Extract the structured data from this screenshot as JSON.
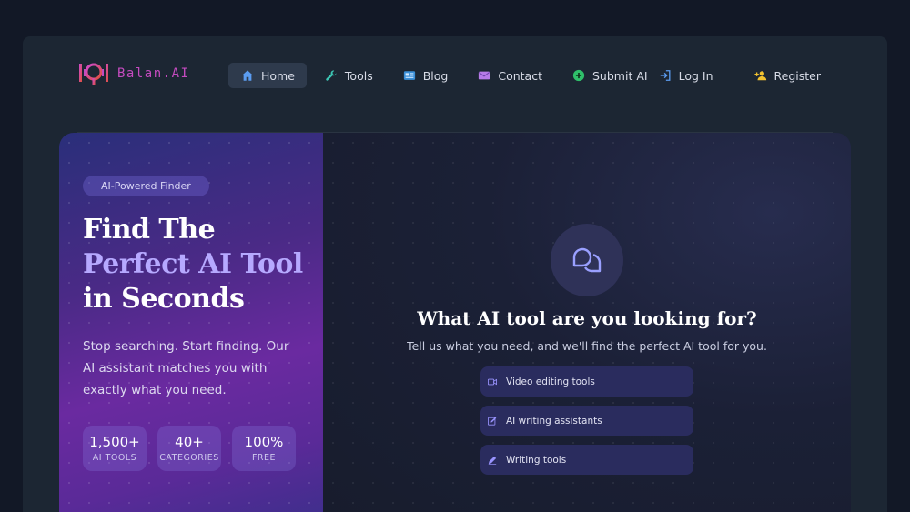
{
  "brand": {
    "name": "Balan.AI"
  },
  "nav": {
    "home": "Home",
    "tools": "Tools",
    "blog": "Blog",
    "contact": "Contact",
    "submit": "Submit AI",
    "login": "Log In",
    "register": "Register"
  },
  "hero": {
    "badge": "AI-Powered Finder",
    "headline_1": "Find The ",
    "headline_hl": "Perfect AI Tool",
    "headline_2": " in Seconds",
    "subtext": "Stop searching. Start finding. Our AI assistant matches you with exactly what you need.",
    "stats": [
      {
        "num": "1,500+",
        "label": "AI TOOLS"
      },
      {
        "num": "40+",
        "label": "CATEGORIES"
      },
      {
        "num": "100%",
        "label": "FREE"
      }
    ]
  },
  "chat": {
    "title": "What AI tool are you looking for?",
    "subtitle": "Tell us what you need, and we'll find the perfect AI tool for you.",
    "suggestions": [
      {
        "label": "Video editing tools",
        "icon": "video-icon"
      },
      {
        "label": "AI writing assistants",
        "icon": "edit-icon"
      },
      {
        "label": "Writing tools",
        "icon": "pen-icon"
      }
    ]
  },
  "colors": {
    "background": "#121826",
    "accent": "#b6a9ff",
    "brand": "#c44bbf"
  }
}
